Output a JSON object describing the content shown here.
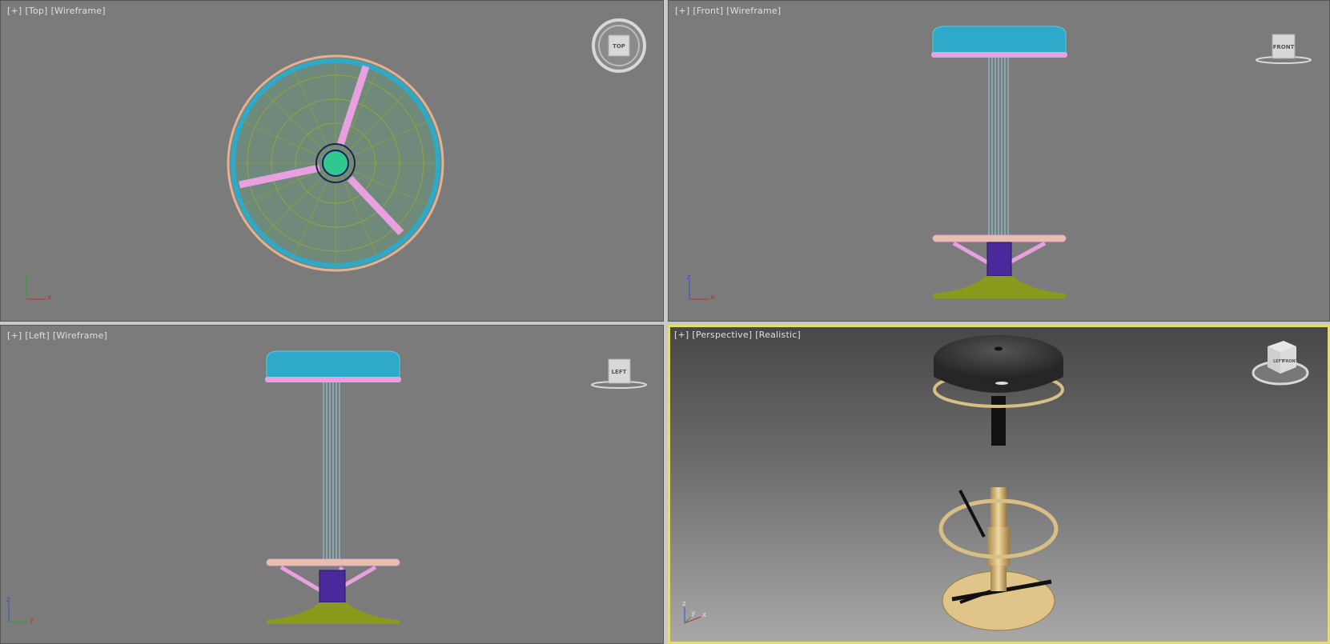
{
  "viewports": {
    "top": {
      "plus": "[+]",
      "view": "[Top]",
      "mode": "[Wireframe]",
      "cube": "TOP",
      "axes": {
        "h": "x",
        "v": "y"
      }
    },
    "front": {
      "plus": "[+]",
      "view": "[Front]",
      "mode": "[Wireframe]",
      "cube": "FRONT",
      "axes": {
        "h": "x",
        "v": "z"
      }
    },
    "left": {
      "plus": "[+]",
      "view": "[Left]",
      "mode": "[Wireframe]",
      "cube": "LEFT",
      "axes": {
        "h": "y",
        "v": "z"
      }
    },
    "perspective": {
      "plus": "[+]",
      "view": "[Perspective]",
      "mode": "[Realistic]",
      "cube_front": "FRONT",
      "cube_left": "LEFT",
      "axes": {
        "h": "x",
        "v": "z",
        "d": "y"
      },
      "active_border": "#e6dc6e"
    }
  },
  "colors": {
    "seat": "#2fa9c9",
    "trim": "#e8a0e0",
    "pole": "#8fd4e6",
    "base": "#8a9a1c",
    "hub": "#3a1a8a",
    "wood": "#d9bf85"
  }
}
